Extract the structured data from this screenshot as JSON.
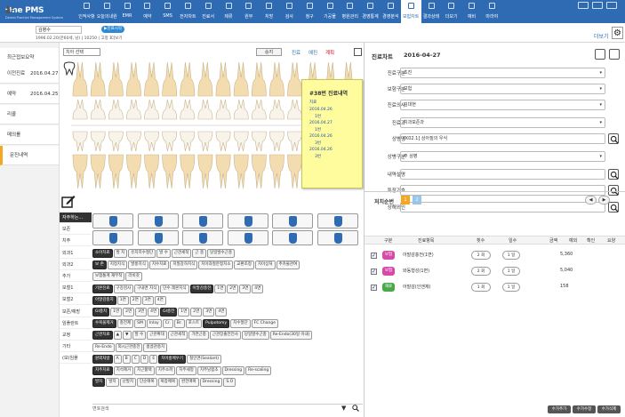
{
  "app": {
    "name": "One PMS",
    "subtitle": "Dental Practice Management System"
  },
  "menu": [
    "인적사항",
    "오늘의내원",
    "EMR",
    "예약",
    "SMS",
    "전자차트",
    "진료서",
    "제류",
    "원무",
    "처방",
    "검사",
    "청구",
    "기공물",
    "병원관리",
    "경영통계",
    "경영분석",
    "보험차트",
    "결과상태",
    "더보기",
    "예비",
    "마라야"
  ],
  "menu_active_index": 16,
  "patient": {
    "name": "김병수",
    "btn": "▶진료시작",
    "info": "1996.02.20(만60세, 남) | 10250 | 고정 1",
    "more": "더보기",
    "more_right": "더보기"
  },
  "leftnav": [
    {
      "label": "최근접보요약",
      "date": ""
    },
    {
      "label": "이전진료",
      "date": "2016.04.27"
    },
    {
      "label": "예약",
      "date": "2016.04.25"
    },
    {
      "label": "리콜",
      "date": ""
    },
    {
      "label": "메의를",
      "date": ""
    },
    {
      "label": "문진내역",
      "date": ""
    }
  ],
  "center": {
    "select": "치아 선택",
    "ok": "승지",
    "tabs": [
      "진료",
      "예진",
      "계획"
    ],
    "popup": {
      "title": "#38번 진료내역",
      "lines": [
        "지료",
        "2016.04.26",
        "1번",
        "2016.04.27",
        "1번",
        "2016.04.26",
        "3번",
        "2016.04.26",
        "3번"
      ]
    },
    "categories": [
      "자주하는...",
      "보존",
      "치주",
      "외과1",
      "외과2",
      "추가",
      "보철1",
      "보철2",
      "보존/예방",
      "임플란트",
      "교정",
      "기타",
      "(보)임플"
    ],
    "button_rows": [
      [
        "소아치료",
        "발 치",
        "유치치수절단",
        "발 수",
        "근관세척",
        "근 충",
        "당일발수근충"
      ],
      [
        "보 존",
        "지정치식",
        "발홍치식",
        "치수치료",
        "치질강하치식",
        "치아과절한정치소",
        "교환조정",
        "치아상처",
        "추카물관여"
      ],
      [
        "보험통계 재부착",
        "러비갖"
      ],
      [
        "기본진료",
        "구강검사",
        "구내면 치식",
        "단수 레몬치식",
        "아말감충전",
        "1면",
        "2면",
        "3면",
        "4면"
      ],
      [
        "아말감충치",
        "1면",
        "2면",
        "3면",
        "4면"
      ],
      [
        "GI충치",
        "1면",
        "2면",
        "3면",
        "4면",
        "GI충전",
        "1면",
        "2면",
        "3면",
        "4면"
      ],
      [
        "수복물제거",
        "충전제",
        "SM",
        "Inlay",
        "Cr.",
        "Br.",
        "포스트",
        "Pulpotomy",
        "치수절단",
        "FC Change"
      ],
      [
        "근관치료",
        "▲",
        "▼",
        "발 수",
        "근관확대",
        "근관세척",
        "가연근충",
        "근관장출전전사",
        "당일발수근충",
        "Re-Endo(30일 이내)"
      ],
      [
        "Re-Endo",
        "외시근관충전",
        "홈골관충치"
      ],
      [
        "원외처방",
        "A",
        "B",
        "C",
        "D",
        "E",
        "치아홈메우기",
        "철인면(Sealant)"
      ],
      [
        "치주치료",
        "치석제거",
        "치근활택",
        "치주소파",
        "치주세정",
        "치주낭합초",
        "Dressing",
        "Re-scaling"
      ],
      [
        "발치",
        "발치",
        "난발치",
        "단순매복",
        "복잡매복",
        "완전매복",
        "Dressing",
        "S.O"
      ]
    ],
    "search_placeholder": "변호검색"
  },
  "right": {
    "title": "진료차트",
    "date": "2016-04-27",
    "fields": [
      {
        "label": "진료구분",
        "value": "초진",
        "search": false
      },
      {
        "label": "보험구분",
        "value": "보험",
        "search": false
      },
      {
        "label": "진료의사",
        "value": "김대현",
        "search": false
      },
      {
        "label": "진료과",
        "value": "치과보존과",
        "search": false
      },
      {
        "label": "상병명",
        "value": "[K02.1] 상아질의 우식",
        "search": true
      },
      {
        "label": "상병구분",
        "value": "주 상병",
        "search": false
      },
      {
        "label": "내역설명",
        "value": "",
        "search": true
      },
      {
        "label": "특정기호",
        "value": "",
        "search": true
      },
      {
        "label": "상해외인",
        "value": "",
        "search": true
      }
    ],
    "rx_title": "처치순번",
    "rx_nums": [
      "1",
      "2"
    ],
    "rx_nav": [
      "◀",
      "▶"
    ],
    "table_headers": [
      "구분",
      "진료항목",
      "횟수",
      "일수",
      "금액",
      "예외",
      "확인",
      "요양"
    ],
    "rows": [
      {
        "tag": "보험",
        "tag_color": "#d64aa8",
        "name": "아말감충전(1면)",
        "count": "2 회",
        "days": "1 일",
        "amount": "5,360"
      },
      {
        "tag": "보험",
        "tag_color": "#d64aa8",
        "name": "와동형성(1면)",
        "count": "2 회",
        "days": "1 일",
        "amount": "5,040"
      },
      {
        "tag": "재료",
        "tag_color": "#4aa84a",
        "name": "아말감(인앤제)",
        "count": "1 회",
        "days": "1 일",
        "amount": "158"
      }
    ],
    "bottom_buttons": [
      "수가추가",
      "수가수정",
      "수가삭제"
    ]
  }
}
